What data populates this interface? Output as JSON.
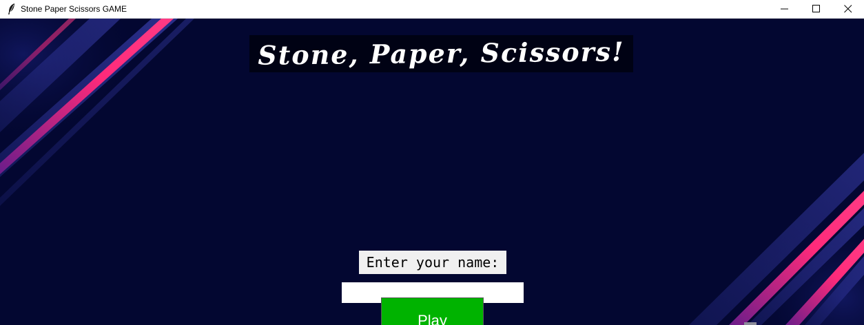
{
  "window": {
    "title": "Stone Paper Scissors GAME",
    "app_icon": "feather-icon",
    "controls": [
      "minimize-icon",
      "maximize-icon",
      "close-icon"
    ]
  },
  "game": {
    "title": "Stone, Paper, Scissors!",
    "name_label": "Enter your name:",
    "name_input_value": "",
    "play_label": "Play"
  },
  "colors": {
    "background": "#030731",
    "title_banner": "#000214",
    "stripe_pink": "#ff2a7a",
    "stripe_blue": "#2a2f8f",
    "play_button": "#00b300"
  }
}
